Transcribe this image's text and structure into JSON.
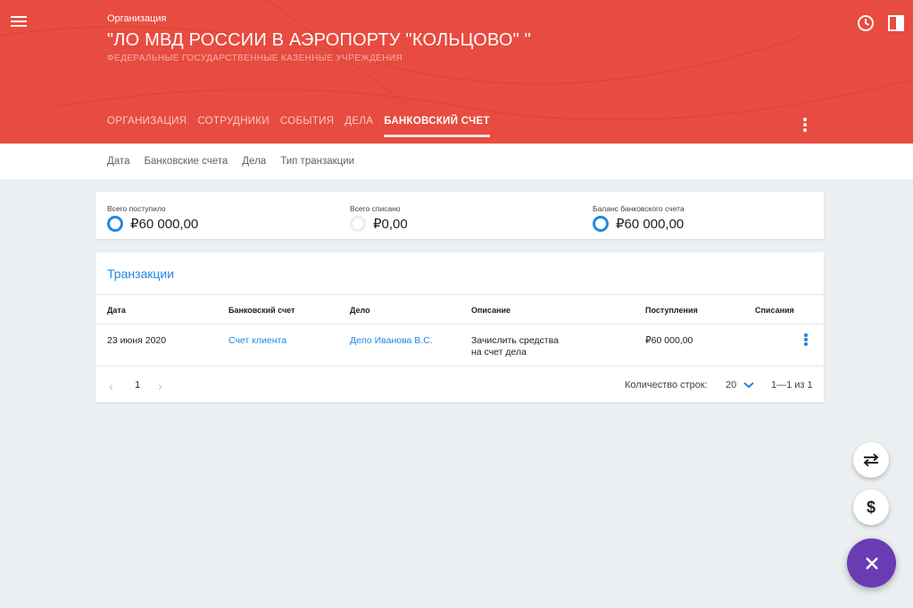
{
  "header": {
    "org_label": "Организация",
    "org_title": "\"ЛО МВД РОССИИ В АЭРОПОРТУ \"КОЛЬЦОВО\" \"",
    "org_subtitle": "ФЕДЕРАЛЬНЫЕ ГОСУДАРСТВЕННЫЕ КАЗЕННЫЕ УЧРЕЖДЕНИЯ",
    "icons": [
      "menu-icon",
      "clock-icon",
      "panel-icon",
      "more-vert-icon"
    ],
    "accent_color": "#e84b3f",
    "tabs": [
      {
        "label": "ОРГАНИЗАЦИЯ",
        "active": false
      },
      {
        "label": "СОТРУДНИКИ",
        "active": false
      },
      {
        "label": "СОБЫТИЯ",
        "active": false
      },
      {
        "label": "ДЕЛА",
        "active": false
      },
      {
        "label": "БАНКОВСКИЙ СЧЕТ",
        "active": true
      }
    ]
  },
  "filters": [
    "Дата",
    "Банковские счета",
    "Дела",
    "Тип транзакции"
  ],
  "summary": {
    "received_label": "Всего поступило",
    "received_value": "₽60 000,00",
    "written_off_label": "Всего списано",
    "written_off_value": "₽0,00",
    "balance_label": "Баланс банковского счета",
    "balance_value": "₽60 000,00"
  },
  "transactions": {
    "title": "Транзакции",
    "columns": [
      "Дата",
      "Банковский счет",
      "Дело",
      "Описание",
      "Поступления",
      "Списания"
    ],
    "rows": [
      {
        "date": "23 июня 2020",
        "account": "Счет клиента",
        "case": "Дело Иванова В.С.",
        "description_1": "Зачислить средства",
        "description_2": "на счет дела",
        "income": "₽60 000,00",
        "expense": ""
      }
    ],
    "pagination": {
      "page": "1",
      "rows_label": "Количество строк:",
      "rows_value": "20",
      "range": "1—1 из 1"
    }
  },
  "fab": {
    "icons": [
      "swap-icon",
      "dollar-icon",
      "close-icon"
    ],
    "dollar_symbol": "$",
    "main_color": "#6a3bb3"
  }
}
